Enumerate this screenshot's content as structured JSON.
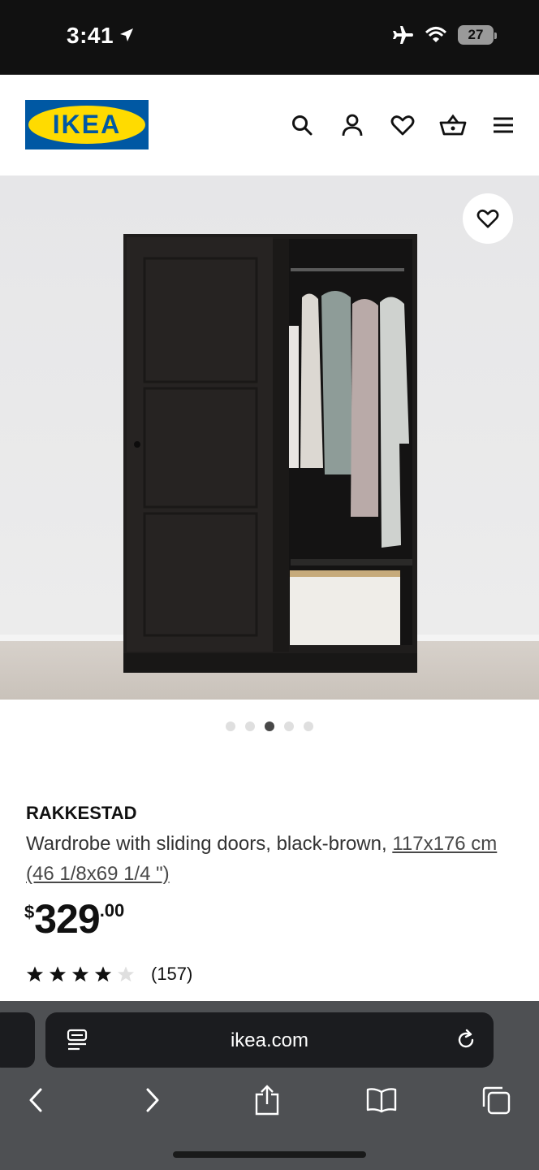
{
  "status_bar": {
    "time": "3:41",
    "battery": "27"
  },
  "header": {
    "logo_text": "IKEA"
  },
  "icons": {
    "search": "search-icon",
    "account": "user-icon",
    "favorites": "heart-icon",
    "basket": "basket-icon",
    "menu": "hamburger-menu-icon"
  },
  "gallery": {
    "image_count": 5,
    "active_index": 2
  },
  "product": {
    "name": "RAKKESTAD",
    "description": "Wardrobe with sliding doors, black-brown,",
    "size_link": "117x176 cm (46 1/8x69 1/4 \")",
    "price": {
      "currency": "$",
      "integer": "329",
      "decimal": ".00"
    },
    "rating": {
      "stars": 4,
      "max": 5,
      "count": "(157)"
    }
  },
  "browser": {
    "url": "ikea.com"
  },
  "colors": {
    "ikea_blue": "#0058a3",
    "ikea_yellow": "#ffdb00"
  }
}
